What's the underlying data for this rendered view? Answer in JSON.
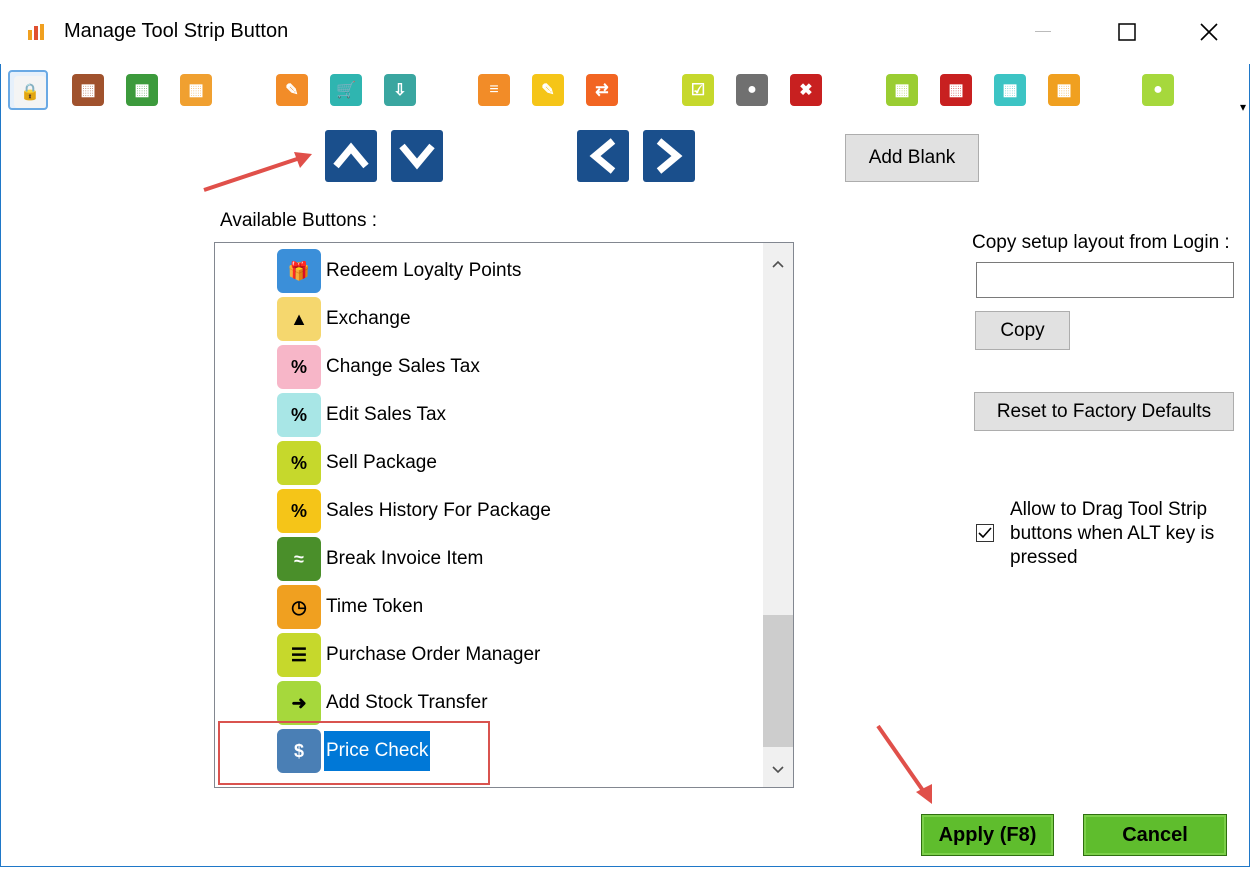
{
  "window": {
    "title": "Manage Tool Strip Button"
  },
  "toolstrip": {
    "buttons": [
      {
        "name": "lock",
        "color": "#f4f4f4",
        "glyph": "🔒"
      },
      {
        "name": "invoice",
        "color": "#a0522d",
        "glyph": "▦"
      },
      {
        "name": "return",
        "color": "#3c9a3c",
        "glyph": "▦"
      },
      {
        "name": "transfer",
        "color": "#f0a030",
        "glyph": "▦"
      },
      {
        "name": "edit",
        "color": "#f28c28",
        "glyph": "✎"
      },
      {
        "name": "cart",
        "color": "#2fb5b0",
        "glyph": "🛒"
      },
      {
        "name": "gift",
        "color": "#3aa6a0",
        "glyph": "⇩"
      },
      {
        "name": "stack",
        "color": "#f28c28",
        "glyph": "≡"
      },
      {
        "name": "note",
        "color": "#f5c518",
        "glyph": "✎"
      },
      {
        "name": "clipboard",
        "color": "#f26522",
        "glyph": "⇄"
      },
      {
        "name": "checklist",
        "color": "#c6d82c",
        "glyph": "☑"
      },
      {
        "name": "spot",
        "color": "#707070",
        "glyph": "●"
      },
      {
        "name": "cancel",
        "color": "#c82020",
        "glyph": "✖"
      },
      {
        "name": "calculator",
        "color": "#9acd32",
        "glyph": "▦"
      },
      {
        "name": "ty-kg",
        "color": "#c82020",
        "glyph": "▦"
      },
      {
        "name": "rs-calc",
        "color": "#3cc4c4",
        "glyph": "▦"
      },
      {
        "name": "tiles",
        "color": "#f0a020",
        "glyph": "▦"
      },
      {
        "name": "user",
        "color": "#a6d83c",
        "glyph": "●"
      }
    ]
  },
  "buttons": {
    "add_blank": "Add Blank",
    "copy": "Copy",
    "reset": "Reset to Factory Defaults",
    "apply": "Apply (F8)",
    "cancel": "Cancel"
  },
  "available": {
    "label": "Available  Buttons :",
    "items": [
      {
        "label": "Redeem Loyalty Points",
        "icon": "gift-icon",
        "color": "#3b8fd9",
        "glyph": "🎁"
      },
      {
        "label": "Exchange",
        "icon": "exchange-icon",
        "color": "#f5d76e",
        "glyph": "▲"
      },
      {
        "label": "Change Sales Tax",
        "icon": "percent-icon",
        "color": "#f7b6c8",
        "glyph": "%"
      },
      {
        "label": "Edit Sales Tax",
        "icon": "percent-edit-icon",
        "color": "#a8e6e6",
        "glyph": "%"
      },
      {
        "label": "Sell Package",
        "icon": "package-icon",
        "color": "#c6d82c",
        "glyph": "%"
      },
      {
        "label": "Sales History For Package",
        "icon": "package-history-icon",
        "color": "#f5c518",
        "glyph": "%"
      },
      {
        "label": "Break Invoice Item",
        "icon": "break-icon",
        "color": "#4a8f2a",
        "glyph": "≈"
      },
      {
        "label": "Time Token",
        "icon": "clock-icon",
        "color": "#f0a020",
        "glyph": "◷"
      },
      {
        "label": "Purchase Order Manager",
        "icon": "checklist-icon",
        "color": "#c6d82c",
        "glyph": "☰"
      },
      {
        "label": "Add Stock Transfer",
        "icon": "stock-transfer-icon",
        "color": "#a6d83c",
        "glyph": "➜"
      },
      {
        "label": "Price Check",
        "icon": "dollar-icon",
        "color": "#4a7fb5",
        "glyph": "$"
      }
    ],
    "selected_index": 10
  },
  "copy_setup": {
    "label": "Copy setup layout from Login :",
    "value": ""
  },
  "drag_option": {
    "label": "Allow to Drag Tool Strip buttons when ALT key is pressed",
    "checked": true
  },
  "colors": {
    "accent": "#0078d7",
    "nav_button": "#1a4f8c",
    "apply_green": "#5fbd2d",
    "annotation_red": "#d9534f"
  }
}
